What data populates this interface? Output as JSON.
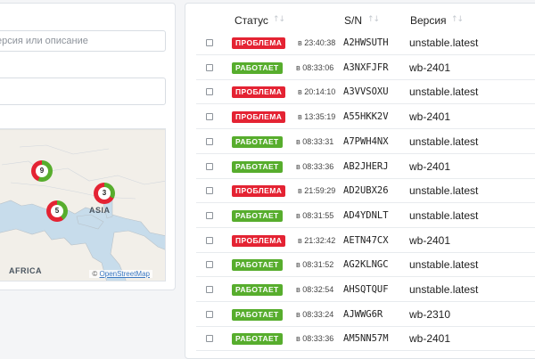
{
  "left": {
    "search_placeholder": "ерсия или описание",
    "map": {
      "labels": {
        "asia": "ASIA",
        "africa": "AFRICA"
      },
      "attribution": "OpenStreetMap",
      "clusters": [
        {
          "count": "9",
          "online_fraction": 0.56
        },
        {
          "count": "5",
          "online_fraction": 0.4
        },
        {
          "count": "3",
          "online_fraction": 0.33
        }
      ]
    }
  },
  "table": {
    "headers": {
      "status": "Статус",
      "serial": "S/N",
      "version": "Версия"
    },
    "colors": {
      "problem": "#e42333",
      "working": "#57ad2d"
    },
    "rows": [
      {
        "status": "ПРОБЛЕМА",
        "status_type": "bad",
        "time": "в 23:40:38",
        "serial": "A2HWSUTH",
        "version": "unstable.latest"
      },
      {
        "status": "РАБОТАЕТ",
        "status_type": "ok",
        "time": "в 08:33:06",
        "serial": "A3NXFJFR",
        "version": "wb-2401"
      },
      {
        "status": "ПРОБЛЕМА",
        "status_type": "bad",
        "time": "в 20:14:10",
        "serial": "A3VVSOXU",
        "version": "unstable.latest"
      },
      {
        "status": "ПРОБЛЕМА",
        "status_type": "bad",
        "time": "в 13:35:19",
        "serial": "A55HKK2V",
        "version": "wb-2401"
      },
      {
        "status": "РАБОТАЕТ",
        "status_type": "ok",
        "time": "в 08:33:31",
        "serial": "A7PWH4NX",
        "version": "unstable.latest"
      },
      {
        "status": "РАБОТАЕТ",
        "status_type": "ok",
        "time": "в 08:33:36",
        "serial": "AB2JHERJ",
        "version": "wb-2401"
      },
      {
        "status": "ПРОБЛЕМА",
        "status_type": "bad",
        "time": "в 21:59:29",
        "serial": "AD2UBX26",
        "version": "unstable.latest"
      },
      {
        "status": "РАБОТАЕТ",
        "status_type": "ok",
        "time": "в 08:31:55",
        "serial": "AD4YDNLT",
        "version": "unstable.latest"
      },
      {
        "status": "ПРОБЛЕМА",
        "status_type": "bad",
        "time": "в 21:32:42",
        "serial": "AETN47CX",
        "version": "wb-2401"
      },
      {
        "status": "РАБОТАЕТ",
        "status_type": "ok",
        "time": "в 08:31:52",
        "serial": "AG2KLNGC",
        "version": "unstable.latest"
      },
      {
        "status": "РАБОТАЕТ",
        "status_type": "ok",
        "time": "в 08:32:54",
        "serial": "AHSQTQUF",
        "version": "unstable.latest"
      },
      {
        "status": "РАБОТАЕТ",
        "status_type": "ok",
        "time": "в 08:33:24",
        "serial": "AJWWG6R",
        "version": "wb-2310"
      },
      {
        "status": "РАБОТАЕТ",
        "status_type": "ok",
        "time": "в 08:33:36",
        "serial": "AM5NN57M",
        "version": "wb-2401"
      }
    ]
  }
}
